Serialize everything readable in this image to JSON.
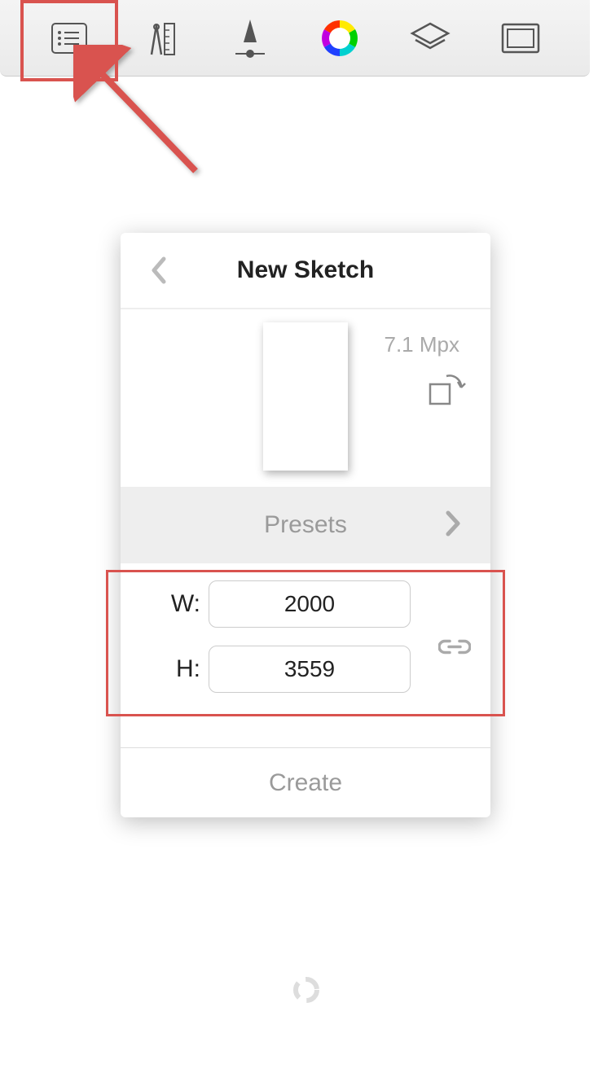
{
  "toolbar": {
    "icons": [
      "list",
      "ruler-compass",
      "brush",
      "color-wheel",
      "layers",
      "fullscreen"
    ]
  },
  "dialog": {
    "title": "New Sketch",
    "megapixels": "7.1 Mpx",
    "presets_label": "Presets",
    "width_label": "W:",
    "height_label": "H:",
    "width_value": "2000",
    "height_value": "3559",
    "create_label": "Create"
  }
}
